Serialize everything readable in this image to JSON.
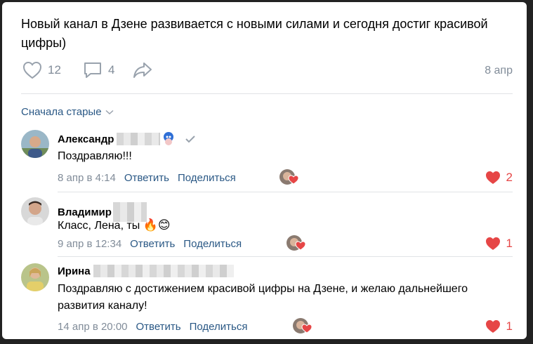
{
  "post": {
    "text": "Новый канал в Дзене развивается с новыми силами и сегодня достиг красивой цифры)",
    "likes": "12",
    "comments": "4",
    "date": "8 апр"
  },
  "sort_label": "Сначала старые",
  "comments": [
    {
      "name": "Александр",
      "text": "Поздравляю!!!",
      "time": "8 апр в 4:14",
      "reply": "Ответить",
      "share": "Поделиться",
      "likes": "2"
    },
    {
      "name": "Владимир",
      "text": "Класс, Лена, ты",
      "emoji": "🔥😊",
      "time": "9 апр в 12:34",
      "reply": "Ответить",
      "share": "Поделиться",
      "likes": "1"
    },
    {
      "name": "Ирина",
      "text": "Поздравляю с достижением красивой цифры на Дзене, и желаю дальнейшего развития каналу!",
      "time": "14 апр в 20:00",
      "reply": "Ответить",
      "share": "Поделиться",
      "likes": "1"
    }
  ],
  "colors": {
    "link": "#2a5885",
    "muted": "#818c99",
    "heart": "#e64646"
  }
}
